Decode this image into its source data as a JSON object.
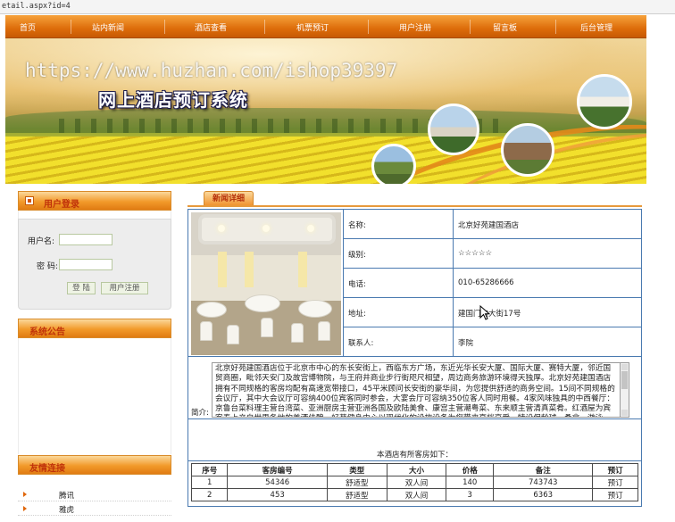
{
  "browser": {
    "url_fragment": "etail.aspx?id=4"
  },
  "nav": {
    "items": [
      "首页",
      "站内新闻",
      "酒店查看",
      "机票预订",
      "用户注册",
      "留言板",
      "后台管理"
    ]
  },
  "banner": {
    "title": "网上酒店预订系统",
    "watermark": "https://www.huzhan.com/ishop39397"
  },
  "sidebar": {
    "login": {
      "heading": "用户登录",
      "username_label": "用户名:",
      "password_label": "密  码:",
      "username_value": "",
      "password_value": "",
      "login_button": "登 陆",
      "register_button": "用户注册"
    },
    "notice": {
      "heading": "系统公告"
    },
    "links": {
      "heading": "友情连接",
      "items": [
        "腾讯",
        "雅虎"
      ]
    }
  },
  "main": {
    "tab_label": "新闻详细",
    "hotel": {
      "fields": [
        {
          "label": "名称:",
          "value": "北京好苑建国酒店"
        },
        {
          "label": "级别:",
          "value": "☆☆☆☆☆"
        },
        {
          "label": "电话:",
          "value": "010-65286666"
        },
        {
          "label": "地址:",
          "value": "建国门内大街17号"
        },
        {
          "label": "联系人:",
          "value": "李院"
        }
      ],
      "intro_label": "简介:",
      "intro_text": "北京好苑建国酒店位于北京市中心的东长安街上，西临东方广场，东近光华长安大厦、国际大厦、赛特大厦，邻近国贸商圈，毗邻天安门及故宫博物院，与王府井商业步行街咫尺相望，周边商务旅游环境得天独厚。北京好苑建国酒店拥有不同规格的客房均配有高速宽带接口，45平米顾问长安街的豪华间，为您提供舒适的商务空间。15间不同规格的会议厅，其中大会议厅可容纳400位宾客同时参会，大宴会厅可容纳350位客人同时用餐。4家风味独具的中西餐厅：京鲁台菜料理主营台湾菜、亚洲厨房主营亚洲各国及欧陆美食、康宫主营潮粤菜、东来顺主营清真菜肴。红酒屋为宾客奉上产自世界各地的美酒佳酿。好苑健身中心以现代化的设施设备为您带来高档享受，特设保龄球、桑拿、游泳池、琴椅健身及健美操房等，饮于酒店以目的境内侍"
    },
    "rooms": {
      "title": "本酒店有所客房如下：",
      "headers": [
        "序号",
        "客房编号",
        "类型",
        "大小",
        "价格",
        "备注",
        "预订"
      ],
      "rows": [
        [
          "1",
          "54346",
          "舒适型",
          "双人间",
          "140",
          "743743",
          "预订"
        ],
        [
          "2",
          "453",
          "舒适型",
          "双人间",
          "3",
          "6363",
          "预订"
        ]
      ]
    }
  },
  "colors": {
    "nav_orange": "#e07b12",
    "table_border_blue": "#4a7ab0",
    "heading_red": "#c0320a"
  }
}
